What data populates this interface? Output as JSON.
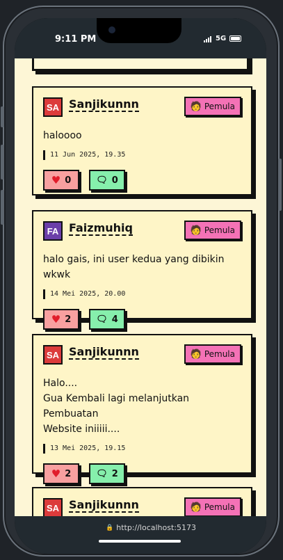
{
  "status": {
    "time": "9:11 PM",
    "network": "5G"
  },
  "browser": {
    "url": "http://localhost:5173"
  },
  "colors": {
    "background": "#fdf6d6",
    "card": "#fef5c7",
    "like_button": "#f8a0a0",
    "comment_button": "#86efac",
    "badge": "#f472b6"
  },
  "posts": [
    {
      "avatar": "SA",
      "avatar_color": "#dc3b3b",
      "username": "Sanjikunnn",
      "badge": "Pemula",
      "badge_icon": "user-avatar-icon",
      "text": "haloooo",
      "timestamp": "11 Jun 2025, 19.35",
      "likes": "0",
      "comments": "0"
    },
    {
      "avatar": "FA",
      "avatar_color": "#6b3fa9",
      "username": "Faizmuhiq",
      "badge": "Pemula",
      "badge_icon": "user-avatar-icon",
      "text": "halo gais, ini user kedua yang dibikin wkwk",
      "timestamp": "14 Mei 2025, 20.00",
      "likes": "2",
      "comments": "4"
    },
    {
      "avatar": "SA",
      "avatar_color": "#dc3b3b",
      "username": "Sanjikunnn",
      "badge": "Pemula",
      "badge_icon": "user-avatar-icon",
      "text_lines": [
        "Halo....",
        "Gua Kembali lagi melanjutkan Pembuatan",
        "Website iniiiii...."
      ],
      "timestamp": "13 Mei 2025, 19.15",
      "likes": "2",
      "comments": "2"
    },
    {
      "avatar": "SA",
      "avatar_color": "#dc3b3b",
      "username": "Sanjikunnn",
      "badge": "Pemula",
      "badge_icon": "user-avatar-icon"
    }
  ]
}
